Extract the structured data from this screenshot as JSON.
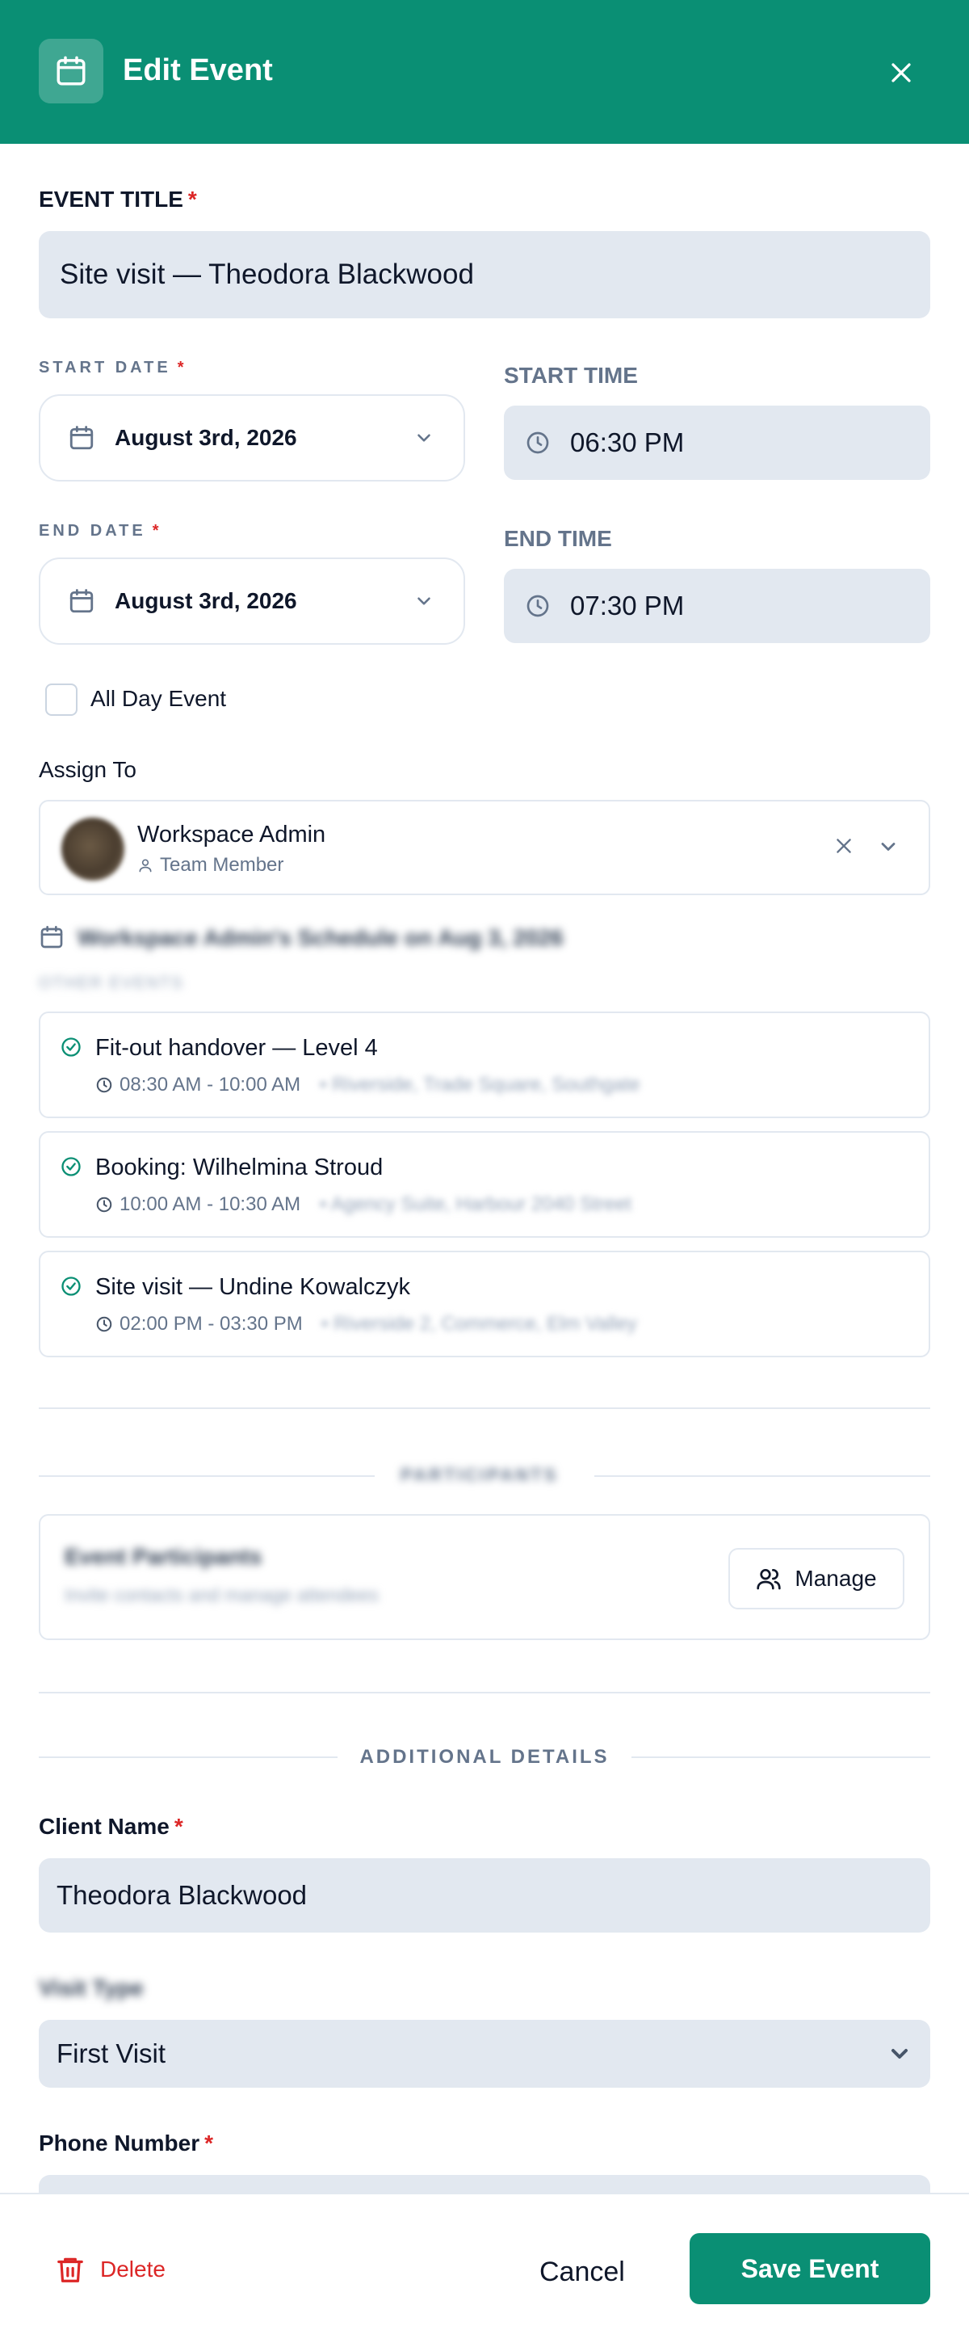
{
  "header": {
    "title": "Edit Event",
    "icon": "calendar-icon",
    "close_icon": "close-icon",
    "bg_color": "#0a8f74"
  },
  "event_title": {
    "label": "EVENT TITLE",
    "required": "*",
    "value": "Site visit — Theodora Blackwood"
  },
  "start_date": {
    "label": "START DATE",
    "required": "*",
    "value": "August 3rd, 2026"
  },
  "start_time": {
    "label": "START TIME",
    "value": "06:30 PM"
  },
  "end_date": {
    "label": "END DATE",
    "required": "*",
    "value": "August 3rd, 2026"
  },
  "end_time": {
    "label": "END TIME",
    "value": "07:30 PM"
  },
  "all_day": {
    "label": "All Day Event",
    "checked": false
  },
  "assign": {
    "label": "Assign To",
    "name": "Workspace Admin",
    "role": "Team Member"
  },
  "schedule": {
    "heading": "Workspace Admin's Schedule on Aug 3, 2026",
    "subheading": "OTHER EVENTS",
    "events": [
      {
        "title": "Fit-out handover — Level 4",
        "time": "08:30 AM - 10:00 AM",
        "location": "• Riverside, Trade Square, Southgate"
      },
      {
        "title": "Booking: Wilhelmina Stroud",
        "time": "10:00 AM - 10:30 AM",
        "location": "• Agency Suite, Harbour 2040 Street"
      },
      {
        "title": "Site visit — Undine Kowalczyk",
        "time": "02:00 PM - 03:30 PM",
        "location": "• Riverside 2, Commerce, Elm Valley"
      }
    ]
  },
  "participants": {
    "section": "PARTICIPANTS",
    "title": "Event Participants",
    "subtitle": "Invite contacts and manage attendees",
    "manage_label": "Manage"
  },
  "additional": {
    "section": "ADDITIONAL DETAILS",
    "client_label": "Client Name",
    "client_required": "*",
    "client_value": "Theodora Blackwood",
    "visit_label": "Visit Type",
    "visit_value": "First Visit",
    "phone_label": "Phone Number",
    "phone_required": "*"
  },
  "footer": {
    "delete_label": "Delete",
    "cancel_label": "Cancel",
    "save_label": "Save Event",
    "accent_color": "#0a8f74",
    "danger_color": "#dc2626"
  }
}
